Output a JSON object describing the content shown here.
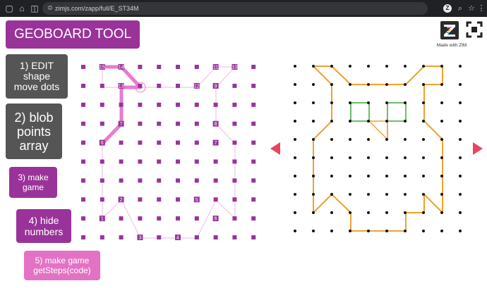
{
  "browser": {
    "url": "zimjs.com/zapp/full/E_ST34M",
    "right_icon_letter": "Z"
  },
  "app": {
    "title": "GEOBOARD TOOL",
    "buttons": [
      {
        "id": "edit",
        "label": "1) EDIT\nshape\nmove dots"
      },
      {
        "id": "blob",
        "label": "2) blob\npoints\narray"
      },
      {
        "id": "make-game",
        "label": "3) make\ngame"
      },
      {
        "id": "hide-numbers",
        "label": "4) hide\nnumbers"
      },
      {
        "id": "make-game-code",
        "label": "5) make game\ngetSteps(code)"
      }
    ],
    "logo_caption": "Made with ZIM"
  },
  "colors": {
    "purple": "#993399",
    "gray_button": "#555555",
    "pink_button": "#e472c4",
    "shape_line": "#f0b8e6",
    "shape_thick": "#e87bd1",
    "game_outline": "#f0a030",
    "game_green": "#3aa83a",
    "arrow": "#e8465e"
  },
  "left_board": {
    "cols": 10,
    "rows": 10,
    "labels": [
      {
        "col": 1,
        "row": 0,
        "text": "15"
      },
      {
        "col": 2,
        "row": 0,
        "text": "14"
      },
      {
        "col": 7,
        "row": 0,
        "text": "11"
      },
      {
        "col": 8,
        "row": 0,
        "text": "10"
      },
      {
        "col": 2,
        "row": 1,
        "text": "13"
      },
      {
        "col": 6,
        "row": 1,
        "text": "12"
      },
      {
        "col": 7,
        "row": 1,
        "text": "9"
      },
      {
        "col": 2,
        "row": 3,
        "text": "7"
      },
      {
        "col": 7,
        "row": 3,
        "text": "8"
      },
      {
        "col": 1,
        "row": 4,
        "text": "6"
      },
      {
        "col": 7,
        "row": 4,
        "text": "7"
      },
      {
        "col": 2,
        "row": 7,
        "text": "2"
      },
      {
        "col": 6,
        "row": 7,
        "text": "5"
      },
      {
        "col": 1,
        "row": 8,
        "text": "1"
      },
      {
        "col": 7,
        "row": 8,
        "text": "6"
      },
      {
        "col": 3,
        "row": 9,
        "text": "3"
      },
      {
        "col": 5,
        "row": 9,
        "text": "4"
      }
    ]
  },
  "right_board": {
    "cols": 10,
    "rows": 10
  }
}
